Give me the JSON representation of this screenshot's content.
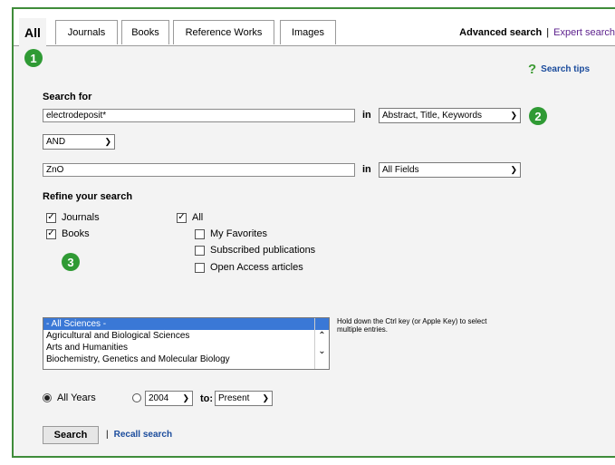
{
  "tabs": [
    {
      "label": "All",
      "active": true
    },
    {
      "label": "Journals"
    },
    {
      "label": "Books"
    },
    {
      "label": "Reference Works"
    },
    {
      "label": "Images"
    }
  ],
  "top_links": {
    "advanced": "Advanced search",
    "separator": "|",
    "expert": "Expert search"
  },
  "badges": {
    "one": "1",
    "two": "2",
    "three": "3"
  },
  "search_tips": {
    "icon": "?",
    "label": "Search tips"
  },
  "search_for": {
    "heading": "Search for",
    "term1": {
      "value": "electrodeposit*",
      "in_label": "in",
      "field": "Abstract, Title, Keywords"
    },
    "operator": "AND",
    "term2": {
      "value": "ZnO",
      "in_label": "in",
      "field": "All Fields"
    }
  },
  "refine": {
    "heading": "Refine your search",
    "journals": "Journals",
    "books": "Books",
    "all": "All",
    "my_favorites": "My Favorites",
    "subscribed": "Subscribed publications",
    "open_access": "Open Access articles"
  },
  "subjects": {
    "items": [
      "- All Sciences -",
      "Agricultural and Biological Sciences",
      "Arts and Humanities",
      "Biochemistry, Genetics and Molecular Biology"
    ],
    "hint": "Hold down the Ctrl key (or Apple Key) to select multiple entries."
  },
  "years": {
    "all_label": "All Years",
    "from": "2004",
    "to_label": "to:",
    "to": "Present"
  },
  "actions": {
    "search": "Search",
    "separator": "|",
    "recall": "Recall search"
  },
  "colors": {
    "accent_green": "#2f9a34",
    "link_blue": "#1a4b9c",
    "expert_purple": "#5b1f8c",
    "frame_green": "#3f8c3a"
  }
}
